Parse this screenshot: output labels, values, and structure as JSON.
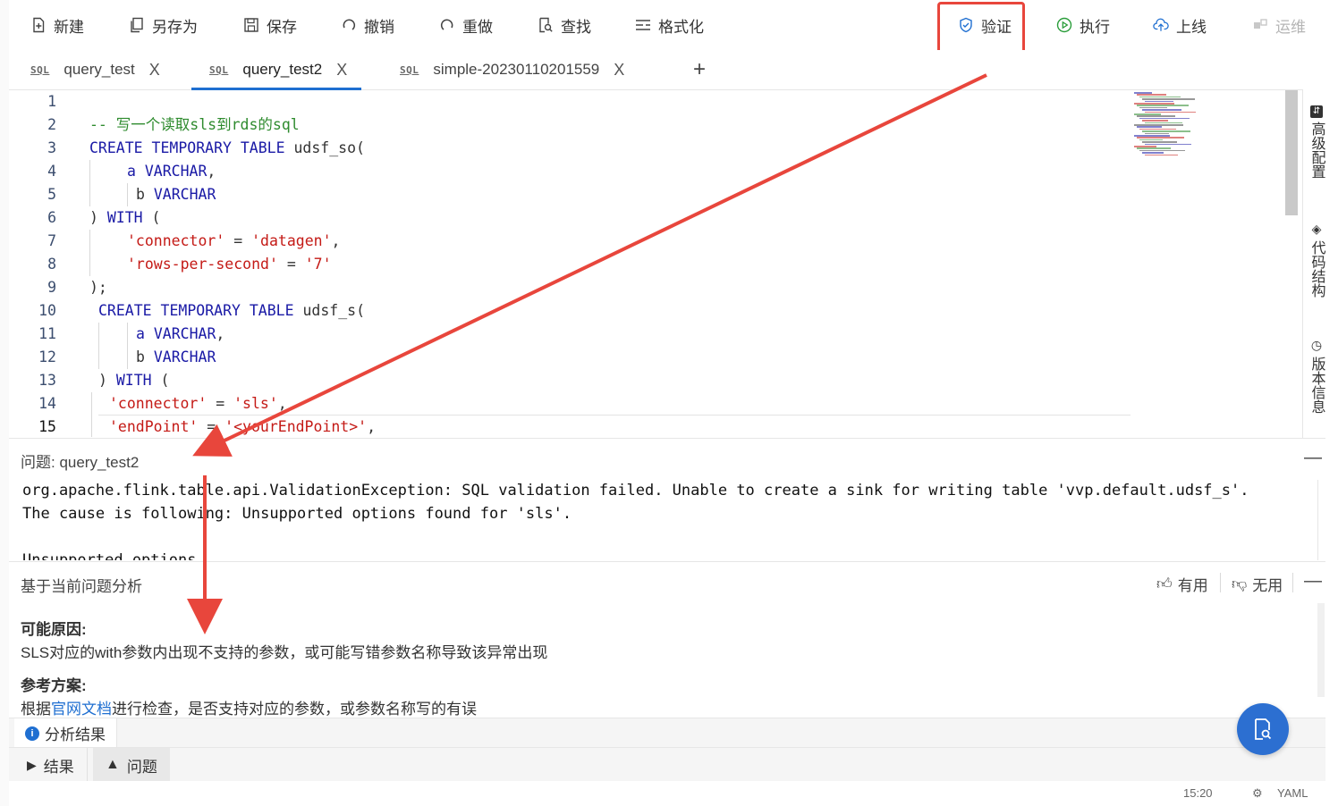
{
  "toolbar": {
    "new": "新建",
    "save_as": "另存为",
    "save": "保存",
    "undo": "撤销",
    "redo": "重做",
    "find": "查找",
    "format": "格式化",
    "validate": "验证",
    "run": "执行",
    "deploy": "上线",
    "ops": "运维"
  },
  "tabs": [
    {
      "tag": "SQL",
      "label": "query_test",
      "close": "X"
    },
    {
      "tag": "SQL",
      "label": "query_test2",
      "close": "X"
    },
    {
      "tag": "SQL",
      "label": "simple-20230110201559",
      "close": "X"
    }
  ],
  "tab_add": "+",
  "editor": {
    "lines": [
      {
        "n": "1"
      },
      {
        "n": "2"
      },
      {
        "n": "3"
      },
      {
        "n": "4"
      },
      {
        "n": "5"
      },
      {
        "n": "6"
      },
      {
        "n": "7"
      },
      {
        "n": "8"
      },
      {
        "n": "9"
      },
      {
        "n": "10"
      },
      {
        "n": "11"
      },
      {
        "n": "12"
      },
      {
        "n": "13"
      },
      {
        "n": "14"
      },
      {
        "n": "15"
      }
    ],
    "tokens": {
      "l2_comment": "-- 写一个读取sls到rds的sql",
      "create_temp_table": "CREATE TEMPORARY TABLE",
      "t1_name": " udsf_so(",
      "col_a": "a",
      "col_b": "b",
      "varchar": "VARCHAR",
      "comma": ",",
      "close_paren": ")",
      "with": "WITH",
      "open_paren": " (",
      "connector_key": "'connector'",
      "eq": " = ",
      "datagen": "'datagen'",
      "rps_key": "'rows-per-second'",
      "rps_val": "'7'",
      "end_stmt": ");",
      "t2_name": " udsf_s(",
      "sls": "'sls'",
      "endpoint_key": "'endPoint'",
      "endpoint_val": "'<yourEndPoint>'"
    }
  },
  "side_panel": {
    "advanced": "高级配置",
    "structure": "代码结构",
    "version": "版本信息"
  },
  "problem": {
    "title": "问题: query_test2",
    "line1": "org.apache.flink.table.api.ValidationException: SQL validation failed. Unable to create a sink for writing table 'vvp.default.udsf_s'.",
    "line2": "The cause is following: Unsupported options found for 'sls'.",
    "line3": "Unsupported options",
    "collapse": "—"
  },
  "analysis": {
    "title": "基于当前问题分析",
    "useful": "有用",
    "useless": "无用",
    "collapse": "—",
    "cause_h": "可能原因:",
    "cause_t": "SLS对应的with参数内出现不支持的参数，或可能写错参数名称导致该异常出现",
    "solution_h": "参考方案:",
    "solution_pre": "根据",
    "solution_link": "官网文档",
    "solution_post": "进行检查，是否支持对应的参数，或参数名称写的有误"
  },
  "result_tabs": {
    "analysis_result": "分析结果"
  },
  "bottom_tabs": {
    "results": "结果",
    "problems": "问题"
  },
  "status": {
    "pos": "15:20",
    "lang": "YAML"
  },
  "colors": {
    "accent": "#1f6fd1",
    "annotation": "#e8463c",
    "keyword": "#1a1aa6",
    "string": "#c41a16",
    "comment": "#2e8b2e"
  }
}
